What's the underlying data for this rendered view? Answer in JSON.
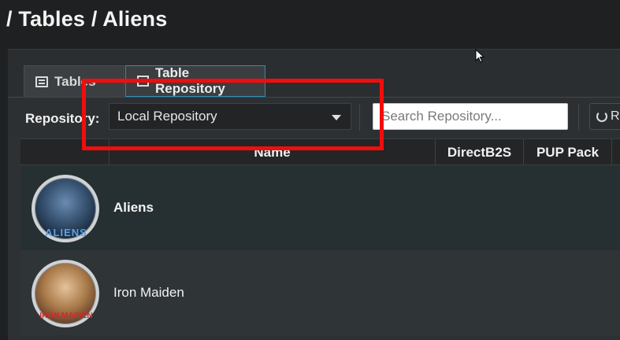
{
  "breadcrumb": {
    "text": "/ Tables / Aliens"
  },
  "tabs": [
    {
      "label": "Tables",
      "icon": "list-icon",
      "active": false
    },
    {
      "label": "Table Repository",
      "icon": "database-icon",
      "active": true
    }
  ],
  "toolbar": {
    "repository_label": "Repository:",
    "repository_value": "Local Repository",
    "search_placeholder": "Search Repository...",
    "search_value": "",
    "refresh_label": "R"
  },
  "table": {
    "columns": [
      "",
      "Name",
      "DirectB2S",
      "PUP Pack"
    ],
    "rows": [
      {
        "name": "Aliens",
        "thumb_caption": "ALIENS",
        "selected": true
      },
      {
        "name": "Iron Maiden",
        "thumb_caption": "IRON MAIDEN",
        "selected": false
      }
    ]
  },
  "colors": {
    "annotation": "#f20d0d",
    "active_tab_border": "#2d8fb8",
    "background": "#1f2021"
  }
}
